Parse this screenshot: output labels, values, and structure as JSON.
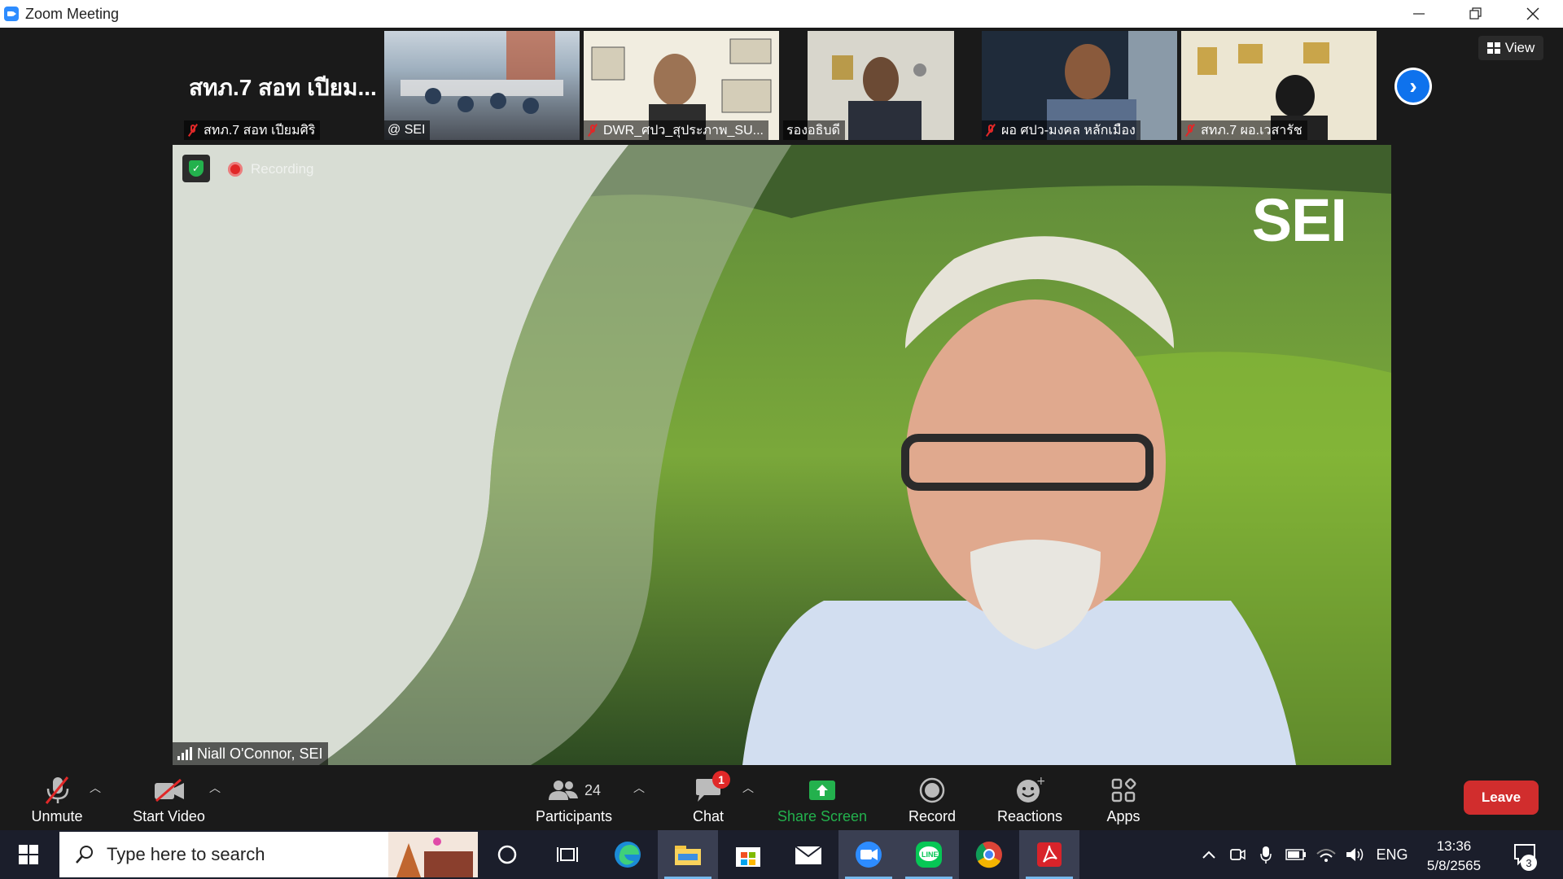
{
  "window": {
    "title": "Zoom Meeting",
    "controls": [
      "minimize",
      "restore",
      "close"
    ]
  },
  "gallery": {
    "tiles": [
      {
        "name": "สทภ.7 สอท เปียมศิริ",
        "display_text": "สทภ.7 สอท เปียม...",
        "muted": true
      },
      {
        "name": "@ SEI",
        "muted": false
      },
      {
        "name": "DWR_ศปว_สุประภาพ_SU...",
        "muted": true
      },
      {
        "name": "รองอธิบดี",
        "muted": false
      },
      {
        "name": "ผอ ศปว-มงคล หลักเมือง",
        "muted": true
      },
      {
        "name": "สทภ.7 ผอ.เวสารัช",
        "muted": true
      }
    ],
    "view_label": "View",
    "next_icon": "chevron-right-icon"
  },
  "main_video": {
    "speaker_name": "Niall O'Connor, SEI",
    "recording_label": "Recording",
    "background_logo": "SEI",
    "security_icon": "shield-check-icon"
  },
  "toolbar": {
    "unmute": "Unmute",
    "start_video": "Start Video",
    "participants": "Participants",
    "participants_count": "24",
    "chat": "Chat",
    "chat_badge": "1",
    "share_screen": "Share Screen",
    "record": "Record",
    "reactions": "Reactions",
    "apps": "Apps",
    "leave": "Leave",
    "share_color": "#23b14d",
    "leave_color": "#d12d2d"
  },
  "taskbar": {
    "search_placeholder": "Type here to search",
    "apps": [
      "cortana-icon",
      "task-view-icon",
      "edge-icon",
      "file-explorer-icon",
      "store-icon",
      "mail-icon",
      "zoom-icon",
      "line-icon",
      "chrome-icon",
      "acrobat-icon"
    ],
    "language": "ENG",
    "time": "13:36",
    "date": "5/8/2565",
    "notification_count": "3"
  }
}
